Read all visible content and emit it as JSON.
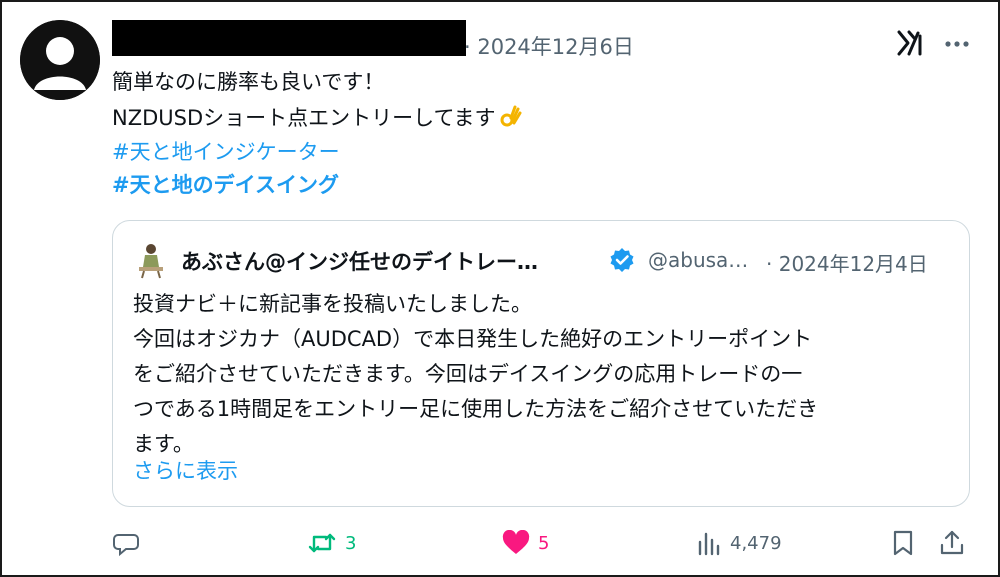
{
  "post": {
    "timestamp": "· 2024年12月6日",
    "lines": [
      "簡単なのに勝率も良いです！",
      "NZDUSDショート点エントリーしてます"
    ],
    "hashtags": [
      "#天と地インジケーター",
      "#天と地のデイスイング"
    ]
  },
  "quote": {
    "name": "あぶさん@インジ任せのデイトレー…",
    "handle": "@abusa…",
    "date": "· 2024年12月4日",
    "body": [
      "投資ナビ＋に新記事を投稿いたしました。",
      "今回はオジカナ（AUDCAD）で本日発生した絶好のエントリーポイント",
      "をご紹介させていただきます。今回はデイスイングの応用トレードの一",
      "つである1時間足をエントリー足に使用した方法をご紹介させていただき",
      "ます。"
    ],
    "show_more": "さらに表示"
  },
  "actions": {
    "retweets": "3",
    "likes": "5",
    "views": "4,479"
  },
  "colors": {
    "link": "#1d9bf0",
    "retweet": "#00ba7c",
    "like": "#f91880",
    "muted": "#536471"
  },
  "icons": {
    "header": [
      "user-avatar-icon",
      "xai-grok-icon",
      "more-icon"
    ],
    "quote": [
      "author-avatar",
      "verified-badge-icon"
    ],
    "emoji": "ok-hand-emoji",
    "actions": [
      "reply-icon",
      "retweet-icon",
      "like-heart-icon",
      "views-chart-icon",
      "bookmark-icon",
      "share-icon"
    ]
  }
}
